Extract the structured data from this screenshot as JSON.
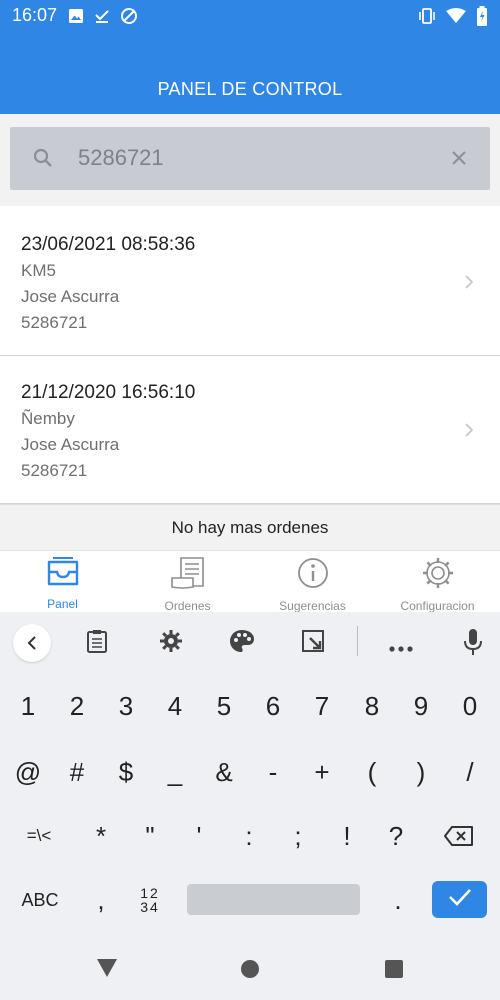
{
  "status_bar": {
    "time": "16:07",
    "left_icons": [
      "image-icon",
      "download-done-icon",
      "sync-disabled-icon"
    ],
    "right_icons": [
      "vibrate-icon",
      "wifi-icon",
      "battery-icon"
    ]
  },
  "app_bar": {
    "title": "PANEL DE CONTROL"
  },
  "search": {
    "value": "5286721",
    "placeholder": ""
  },
  "orders": [
    {
      "datetime": "23/06/2021 08:58:36",
      "location": "KM5",
      "name": "Jose Ascurra",
      "code": "5286721"
    },
    {
      "datetime": "21/12/2020 16:56:10",
      "location": "Ñemby",
      "name": "Jose Ascurra",
      "code": "5286721"
    }
  ],
  "list_footer": "No hay mas ordenes",
  "tabs": [
    {
      "label": "Panel",
      "icon": "inbox-tray-icon",
      "active": true
    },
    {
      "label": "Ordenes",
      "icon": "receipt-icon",
      "active": false
    },
    {
      "label": "Sugerencias",
      "icon": "info-icon",
      "active": false
    },
    {
      "label": "Configuracion",
      "icon": "gear-icon",
      "active": false
    }
  ],
  "keyboard": {
    "toolbar_icons": [
      "back-chevron-icon",
      "clipboard-icon",
      "settings-icon",
      "palette-icon",
      "resize-icon",
      "more-icon",
      "mic-icon"
    ],
    "row1": [
      "1",
      "2",
      "3",
      "4",
      "5",
      "6",
      "7",
      "8",
      "9",
      "0"
    ],
    "row2": [
      "@",
      "#",
      "$",
      "_",
      "&",
      "-",
      "+",
      "(",
      ")",
      "/"
    ],
    "row3": [
      "=\\<",
      "*",
      "\"",
      "'",
      ":",
      ";",
      "!",
      "?"
    ],
    "row4": {
      "abc": "ABC",
      "comma": ",",
      "nums_top": "12",
      "nums_bottom": "34",
      "period": "."
    }
  },
  "colors": {
    "primary": "#2f86e4",
    "keyboard_bg": "#eef0f3"
  }
}
